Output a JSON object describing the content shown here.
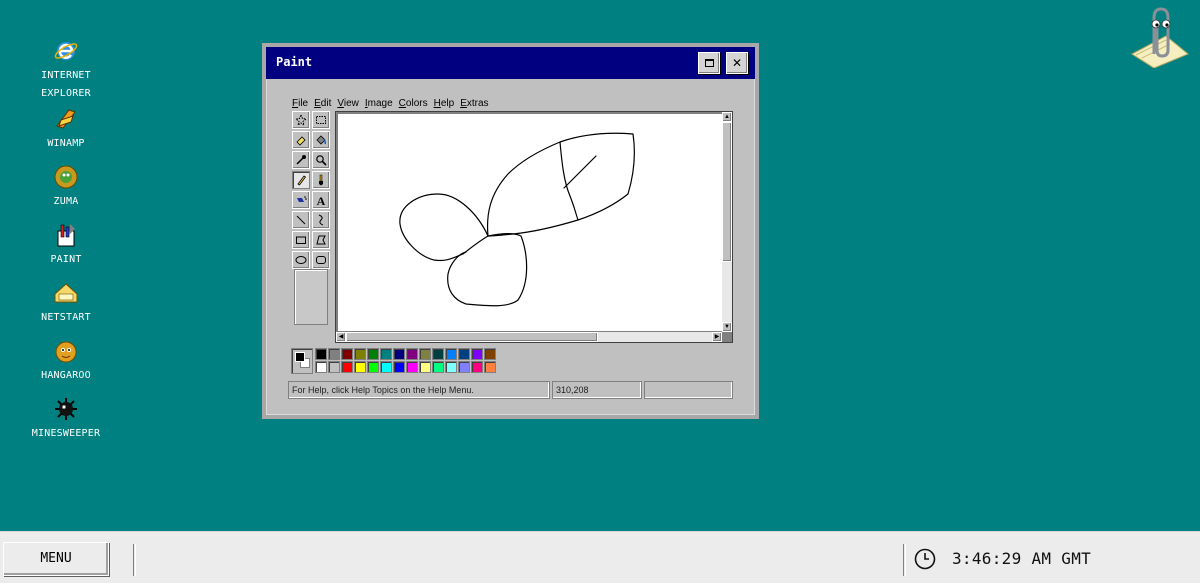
{
  "desktop": {
    "icons": [
      {
        "label": "INTERNET\nEXPLORER",
        "icon": "internet-explorer-icon"
      },
      {
        "label": "WINAMP",
        "icon": "winamp-icon"
      },
      {
        "label": "ZUMA",
        "icon": "zuma-icon"
      },
      {
        "label": "PAINT",
        "icon": "paint-icon"
      },
      {
        "label": "NETSTART",
        "icon": "netstart-icon"
      },
      {
        "label": "HANGAROO",
        "icon": "hangaroo-icon"
      },
      {
        "label": "MINESWEEPER",
        "icon": "minesweeper-icon"
      }
    ],
    "background_color": "#008080"
  },
  "window": {
    "title": "Paint",
    "maximize_glyph": "maximize-icon",
    "close_glyph": "✕",
    "menu": [
      "File",
      "Edit",
      "View",
      "Image",
      "Colors",
      "Help",
      "Extras"
    ],
    "tools": [
      "free-form-select",
      "rect-select",
      "eraser",
      "fill",
      "color-picker",
      "magnifier",
      "pencil",
      "brush",
      "airbrush",
      "text",
      "line",
      "curve",
      "rectangle",
      "polygon",
      "ellipse",
      "rounded-rectangle"
    ],
    "active_tool": "pencil",
    "palette": {
      "foreground": "#000000",
      "background": "#ffffff",
      "colors_top": [
        "#000000",
        "#808080",
        "#800000",
        "#808000",
        "#008000",
        "#008080",
        "#000080",
        "#800080",
        "#808040",
        "#004040",
        "#0080ff",
        "#004080",
        "#8000ff",
        "#804000"
      ],
      "colors_bottom": [
        "#ffffff",
        "#c0c0c0",
        "#ff0000",
        "#ffff00",
        "#00ff00",
        "#00ffff",
        "#0000ff",
        "#ff00ff",
        "#ffff80",
        "#00ff80",
        "#80ffff",
        "#8080ff",
        "#ff0080",
        "#ff8040"
      ]
    },
    "status": {
      "help": "For Help, click Help Topics on the Help Menu.",
      "coords": "310,208",
      "size": ""
    },
    "title_bar_color": "#000080"
  },
  "taskbar": {
    "menu_label": "MENU",
    "clock": "3:46:29 AM GMT"
  }
}
